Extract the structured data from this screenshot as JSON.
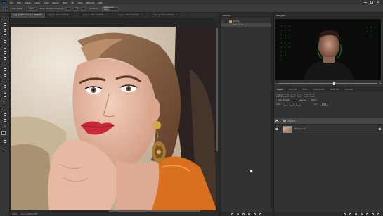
{
  "app": {
    "logo": "Ps"
  },
  "menu": [
    "File",
    "Edit",
    "Image",
    "Layer",
    "Type",
    "Select",
    "Filter",
    "3D",
    "View",
    "Window",
    "Help"
  ],
  "options": {
    "auto_select_label": "Auto-Select:",
    "auto_select_value": "Layer",
    "transform_label": "Show Transform Controls",
    "mode_label": "3D Mode:",
    "select_mask_label": "Select and Mask..."
  },
  "tabs": [
    {
      "label": "1.jpg @ 100% (Group 1, RGB/8#)",
      "active": true
    },
    {
      "label": "2.jpg @ 100% (RGB/8#)",
      "active": false
    },
    {
      "label": "3.jpg @ 100% (RGB/8#)",
      "active": false
    },
    {
      "label": "4.jpg @ 100% (RGB/8#)",
      "active": false
    },
    {
      "label": "5.jpg @ 100% (RGB/8#)",
      "active": false
    }
  ],
  "status": {
    "zoom": "100%",
    "doc_size": "Doc: 2.25M/11.8M"
  },
  "actions": {
    "title": "Actions",
    "items": [
      {
        "label": "Toning",
        "type": "set",
        "selected": false
      },
      {
        "label": "Color Grade",
        "type": "action",
        "selected": true
      }
    ]
  },
  "navigator": {
    "title": "Navigator",
    "zoom": "100%"
  },
  "layers": {
    "tabs": [
      "Layers",
      "Channels",
      "Paths",
      "Adjustments",
      "Properties",
      "Libraries"
    ],
    "active_tab": "Layers",
    "kind_label": "Kind",
    "blend_mode": "Pass Through",
    "opacity_label": "Opacity:",
    "opacity_value": "100%",
    "lock_label": "Lock:",
    "fill_label": "Fill:",
    "fill_value": "100%",
    "items": [
      {
        "name": "Group 1",
        "type": "group",
        "selected": true
      },
      {
        "name": "Background",
        "type": "image",
        "selected": false
      }
    ]
  },
  "colors": {
    "accent": "#31a8ff",
    "panel": "#323232",
    "selection": "#474747"
  }
}
